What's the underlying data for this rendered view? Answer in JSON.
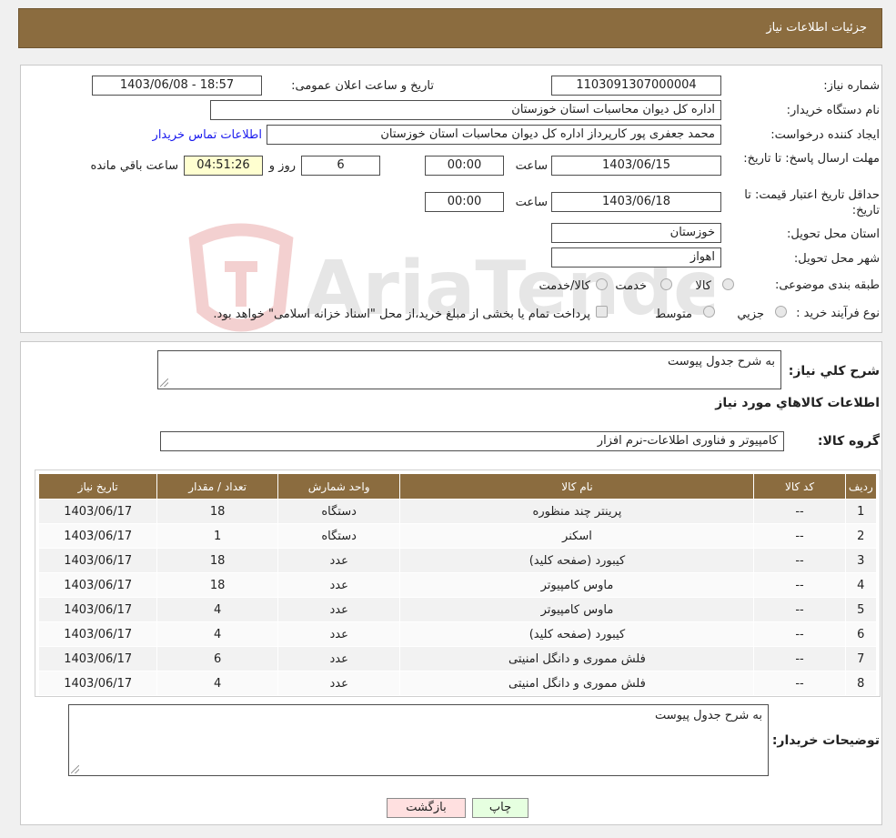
{
  "header": {
    "title": "جزئیات اطلاعات نیاز"
  },
  "form": {
    "need_number_label": "شماره نیاز:",
    "need_number": "1103091307000004",
    "announce_label": "تاریخ و ساعت اعلان عمومی:",
    "announce_value": "1403/06/08 - 18:57",
    "buyer_org_label": "نام دستگاه خریدار:",
    "buyer_org": "اداره کل دیوان محاسبات استان خوزستان",
    "requester_label": "ایجاد کننده درخواست:",
    "requester": "محمد جعفری پور کارپرداز اداره کل دیوان محاسبات استان خوزستان",
    "contact_link": "اطلاعات تماس خریدار",
    "deadline_label": "مهلت ارسال پاسخ: تا تاریخ:",
    "deadline_date": "1403/06/15",
    "time_label": "ساعت",
    "deadline_time": "00:00",
    "days_value": "6",
    "days_label": "روز و",
    "remaining_time": "04:51:26",
    "remaining_label": "ساعت باقي مانده",
    "validity_label": "حداقل تاریخ اعتبار قیمت: تا تاریخ:",
    "validity_date": "1403/06/18",
    "validity_time": "00:00",
    "province_label": "استان محل تحویل:",
    "province": "خوزستان",
    "city_label": "شهر محل تحویل:",
    "city": "اهواز",
    "category_label": "طبقه بندی موضوعی:",
    "category_options": [
      "کالا",
      "خدمت",
      "کالا/خدمت"
    ],
    "process_label": "نوع فرآیند خرید :",
    "process_options": [
      "جزیي",
      "متوسط"
    ],
    "process_note": "پرداخت تمام یا بخشی از مبلغ خرید،از محل \"اسناد خزانه اسلامی\" خواهد بود."
  },
  "details": {
    "summary_label": "شرح كلي نياز:",
    "summary": "به شرح جدول پیوست",
    "items_title": "اطلاعات کالاهاي مورد نياز",
    "group_label": "گروه کالا:",
    "group_value": "کامپیوتر و فناوری اطلاعات-نرم افزار",
    "table": {
      "headers": [
        "رديف",
        "کد کالا",
        "نام کالا",
        "واحد شمارش",
        "تعداد / مقدار",
        "تاریخ نیاز"
      ],
      "rows": [
        [
          "1",
          "--",
          "پرینتر چند منظوره",
          "دستگاه",
          "18",
          "1403/06/17"
        ],
        [
          "2",
          "--",
          "اسکنر",
          "دستگاه",
          "1",
          "1403/06/17"
        ],
        [
          "3",
          "--",
          "کیبورد (صفحه کلید)",
          "عدد",
          "18",
          "1403/06/17"
        ],
        [
          "4",
          "--",
          "ماوس کامپیوتر",
          "عدد",
          "18",
          "1403/06/17"
        ],
        [
          "5",
          "--",
          "ماوس کامپیوتر",
          "عدد",
          "4",
          "1403/06/17"
        ],
        [
          "6",
          "--",
          "کیبورد (صفحه کلید)",
          "عدد",
          "4",
          "1403/06/17"
        ],
        [
          "7",
          "--",
          "فلش مموری و دانگل امنیتی",
          "عدد",
          "6",
          "1403/06/17"
        ],
        [
          "8",
          "--",
          "فلش مموری و دانگل امنیتی",
          "عدد",
          "4",
          "1403/06/17"
        ]
      ]
    },
    "buyer_notes_label": "توضیحات خریدار:",
    "buyer_notes": "به شرح جدول پیوست"
  },
  "buttons": {
    "print": "چاپ",
    "back": "بازگشت"
  },
  "watermark": {
    "text": "AriaTender.neT"
  },
  "colors": {
    "header_bg": "#8b6c3f",
    "link": "#1a1aee",
    "back_button": "#ffe0e0",
    "print_button": "#e6ffe0"
  }
}
